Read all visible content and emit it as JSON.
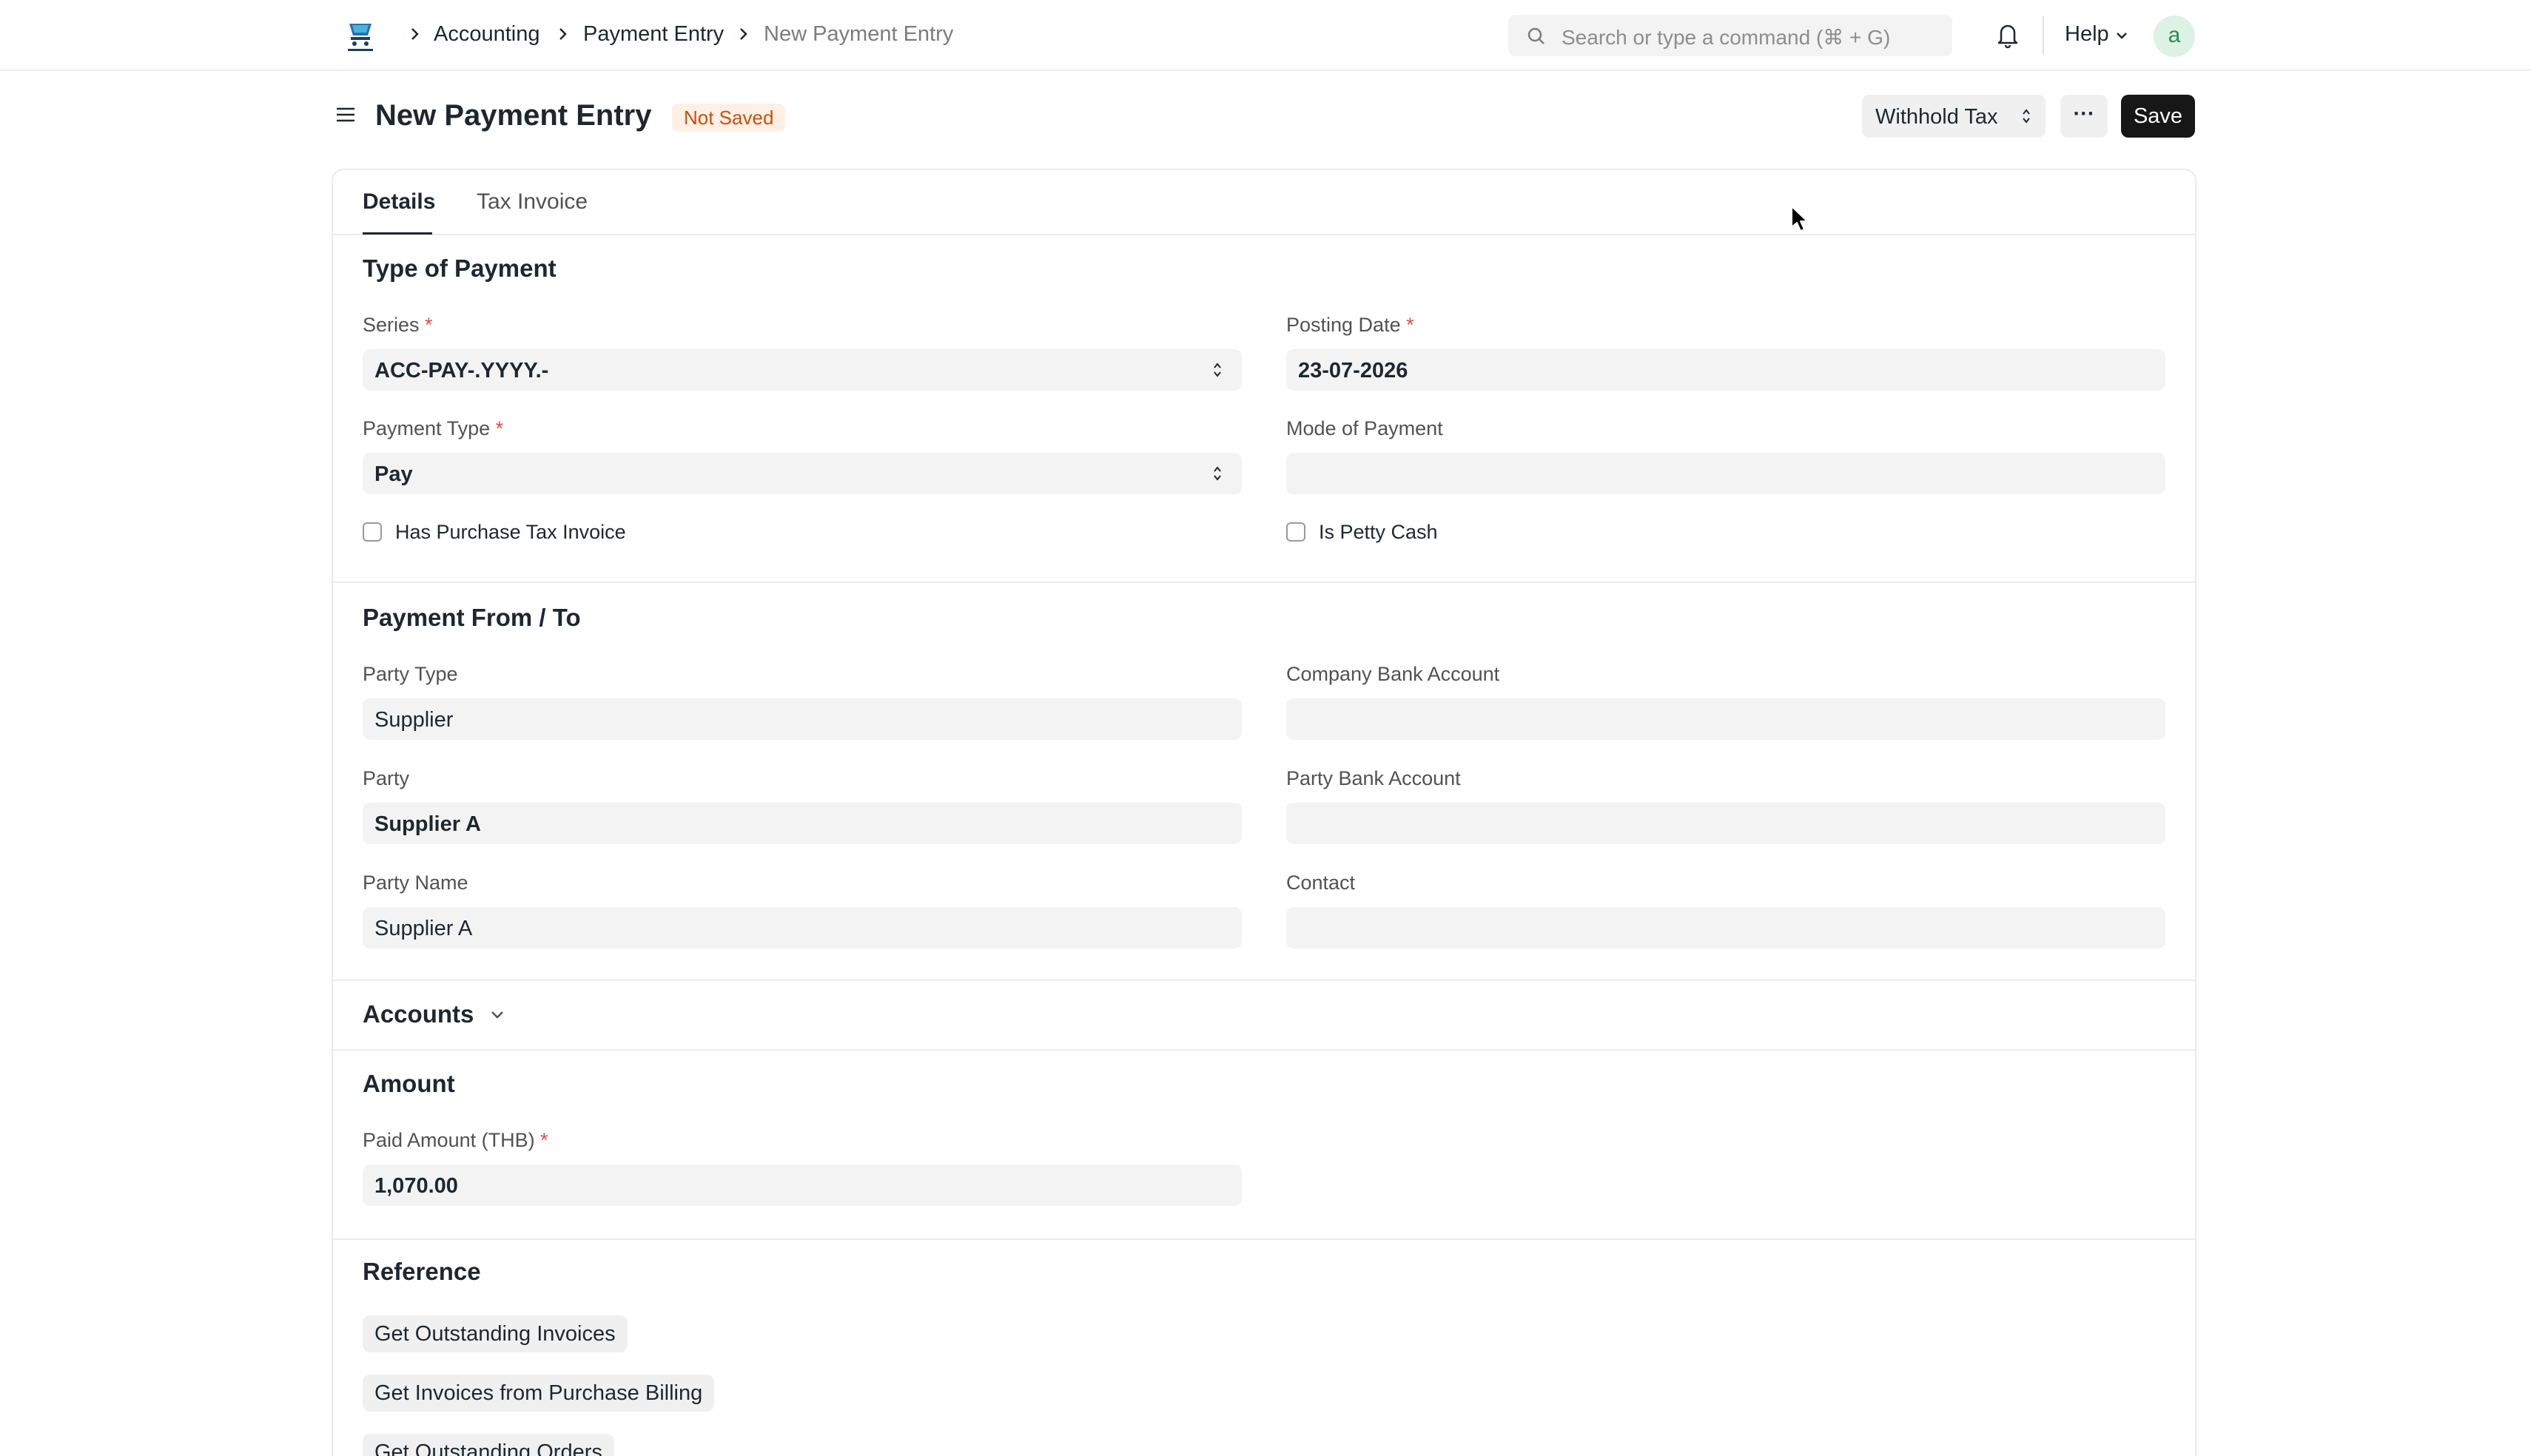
{
  "navbar": {
    "breadcrumbs": [
      "Accounting",
      "Payment Entry",
      "New Payment Entry"
    ],
    "search_placeholder": "Search or type a command (⌘ + G)",
    "help_label": "Help",
    "avatar_letter": "a"
  },
  "header": {
    "title": "New Payment Entry",
    "status_badge": "Not Saved",
    "withhold_tax_label": "Withhold Tax",
    "more_label": "···",
    "save_label": "Save"
  },
  "tabs": [
    {
      "label": "Details",
      "active": true
    },
    {
      "label": "Tax Invoice",
      "active": false
    }
  ],
  "type_of_payment": {
    "title": "Type of Payment",
    "series": {
      "label": "Series",
      "value": "ACC-PAY-.YYYY.-"
    },
    "posting_date": {
      "label": "Posting Date",
      "value": "23-07-2026"
    },
    "payment_type": {
      "label": "Payment Type",
      "value": "Pay"
    },
    "mode_of_payment": {
      "label": "Mode of Payment",
      "value": ""
    },
    "has_purchase_tax_invoice": {
      "label": "Has Purchase Tax Invoice",
      "checked": false
    },
    "is_petty_cash": {
      "label": "Is Petty Cash",
      "checked": false
    }
  },
  "payment_from_to": {
    "title": "Payment From / To",
    "party_type": {
      "label": "Party Type",
      "value": "Supplier"
    },
    "company_bank_account": {
      "label": "Company Bank Account",
      "value": ""
    },
    "party": {
      "label": "Party",
      "value": "Supplier A"
    },
    "party_bank_account": {
      "label": "Party Bank Account",
      "value": ""
    },
    "party_name": {
      "label": "Party Name",
      "value": "Supplier A"
    },
    "contact": {
      "label": "Contact",
      "value": ""
    }
  },
  "accounts": {
    "title": "Accounts"
  },
  "amount": {
    "title": "Amount",
    "paid_amount": {
      "label": "Paid Amount (THB)",
      "value": "1,070.00"
    }
  },
  "reference": {
    "title": "Reference",
    "buttons": [
      "Get Outstanding Invoices",
      "Get Invoices from Purchase Billing",
      "Get Outstanding Orders"
    ]
  },
  "colors": {
    "accent": "#171717",
    "badge_bg": "#fff0e6",
    "badge_text": "#c5500b",
    "required": "#e24c4c"
  }
}
